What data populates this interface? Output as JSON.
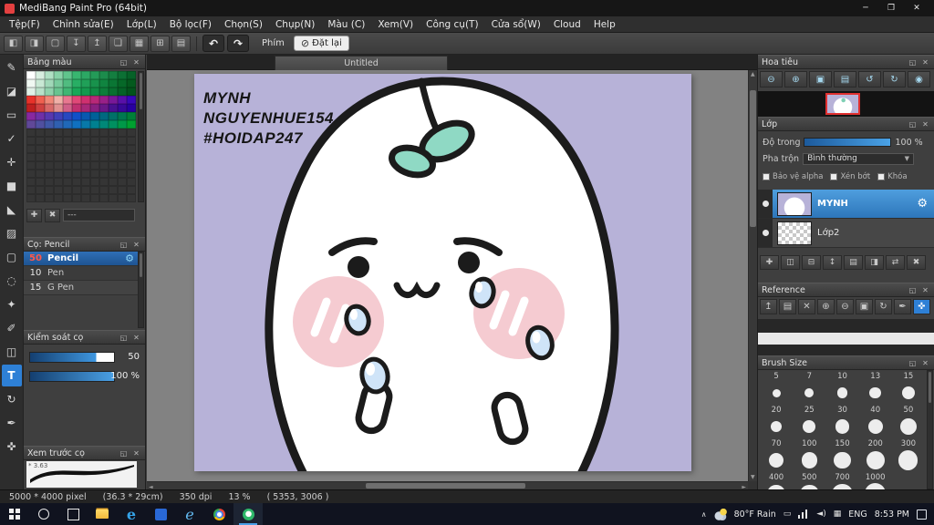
{
  "window": {
    "title": "MediBang Paint Pro (64bit)"
  },
  "menu_bar": {
    "items": [
      "Tệp(F)",
      "Chỉnh sửa(E)",
      "Lớp(L)",
      "Bộ lọc(F)",
      "Chọn(S)",
      "Chụp(N)",
      "Màu (C)",
      "Xem(V)",
      "Công cụ(T)",
      "Cửa sổ(W)",
      "Cloud",
      "Help"
    ]
  },
  "toolbar": {
    "icons": [
      "panels",
      "export",
      "new",
      "save",
      "upload",
      "comment",
      "palette",
      "grid",
      "material"
    ],
    "history": [
      "undo",
      "redo"
    ],
    "phim_label": "Phím",
    "reset_label": "Đặt lại"
  },
  "tools": {
    "items": [
      "brush",
      "eraser",
      "select-rect",
      "draw-check",
      "move",
      "fill",
      "bucket",
      "gradient",
      "select",
      "lasso",
      "magic-wand",
      "select-pen",
      "divide",
      "text",
      "frame",
      "eyedropper",
      "hand"
    ],
    "active": "text"
  },
  "canvas": {
    "tab_title": "Untitled",
    "background": "#b7b2d8",
    "watermark": [
      "MYNH",
      "NGUYENHUE154",
      "#HOIDAP247"
    ],
    "character_colors": {
      "outline": "#1b1b1b",
      "body": "#ffffff",
      "leaf": "#8fd9c4",
      "cheek": "#f5cbd1",
      "tear": "#cfe4f8"
    }
  },
  "panels": {
    "color_palette": {
      "title": "Bảng màu",
      "misc_label": "---",
      "rows": [
        [
          "#ffffff",
          "#d8eee0",
          "#b0e0c4",
          "#88d2a8",
          "#60c48c",
          "#38b670",
          "#2ca864",
          "#249a58",
          "#1c8c4c",
          "#147e40",
          "#0c7034",
          "#066228"
        ],
        [
          "#f0f8f2",
          "#c8e8d4",
          "#a0d8b8",
          "#78ca9c",
          "#50bc80",
          "#28ae64",
          "#20a058",
          "#18924c",
          "#108440",
          "#0a7634",
          "#066828",
          "#045a1e"
        ],
        [
          "#e0f0e6",
          "#b8e0c8",
          "#90d2ac",
          "#68c490",
          "#40b674",
          "#18a858",
          "#149a4e",
          "#108c44",
          "#0c7e3a",
          "#087030",
          "#046226",
          "#02541c"
        ],
        [
          "#e8322a",
          "#f06050",
          "#f08878",
          "#f0b0a8",
          "#e87890",
          "#e04878",
          "#d03070",
          "#b82878",
          "#982088",
          "#781898",
          "#5810a8",
          "#3808b8"
        ],
        [
          "#c02020",
          "#d04040",
          "#d86868",
          "#e09090",
          "#d06088",
          "#c03070",
          "#a82878",
          "#882080",
          "#681888",
          "#481090",
          "#380898",
          "#2800a0"
        ],
        [
          "#8828a0",
          "#7030a8",
          "#5838b0",
          "#4040b8",
          "#2848c0",
          "#1050c8",
          "#0858b0",
          "#006098",
          "#006880",
          "#007068",
          "#007850",
          "#008038"
        ],
        [
          "#604898",
          "#5050a0",
          "#4058a8",
          "#3060b0",
          "#2068b8",
          "#1070c0",
          "#0878a8",
          "#008090",
          "#008878",
          "#009060",
          "#009848",
          "#00a030"
        ]
      ],
      "empty_rows": 9
    },
    "brush": {
      "title": "Cọ: Pencil",
      "items": [
        {
          "size": "50",
          "name": "Pencil",
          "selected": true
        },
        {
          "size": "10",
          "name": "Pen",
          "selected": false
        },
        {
          "size": "15",
          "name": "G Pen",
          "selected": false
        }
      ]
    },
    "brush_control": {
      "title": "Kiểm soát cọ",
      "size_value": "50",
      "opacity_value": "100 %"
    },
    "brush_preview": {
      "title": "Xem trước cọ",
      "scale": "* 3.63"
    },
    "navigator": {
      "title": "Hoa tiêu",
      "icons": [
        "zoom-out",
        "zoom-in",
        "fit",
        "actual",
        "rotate-left",
        "rotate-right",
        "reset-view"
      ]
    },
    "layer": {
      "title": "Lớp",
      "opacity_label": "Độ trong",
      "opacity_value": "100 %",
      "blend_label": "Pha trộn",
      "blend_value": "Bình thường",
      "protect_alpha_label": "Bảo vệ alpha",
      "clip_label": "Xén bớt",
      "lock_label": "Khóa",
      "layers": [
        {
          "name": "MYNH",
          "selected": true
        },
        {
          "name": "Lớp2",
          "selected": false
        }
      ],
      "actions": [
        "layer-add",
        "layer-dup",
        "layer-merge",
        "layer-updown",
        "layer-folder",
        "layer-clip",
        "layer-transfer",
        "layer-delete"
      ]
    },
    "reference": {
      "title": "Reference",
      "icons": [
        "ref-up",
        "ref-folder",
        "ref-close",
        "ref-zoom-in",
        "ref-zoom-out",
        "ref-fit",
        "ref-rotate",
        "ref-eyedropper",
        "ref-hand"
      ],
      "active": "ref-hand"
    },
    "brush_size": {
      "title": "Brush Size",
      "rows": [
        [
          "5",
          "7",
          "10",
          "13",
          "15"
        ],
        [
          "20",
          "25",
          "30",
          "40",
          "50"
        ],
        [
          "70",
          "100",
          "150",
          "200",
          "300"
        ],
        [
          "400",
          "500",
          "700",
          "1000"
        ]
      ]
    }
  },
  "status_bar": {
    "dimensions": "5000 * 4000 pixel",
    "print_size": "(36.3 * 29cm)",
    "dpi": "350 dpi",
    "zoom": "13 %",
    "coords": "( 5353, 3006 )"
  },
  "taskbar": {
    "apps": [
      "start",
      "search",
      "task-view",
      "file-explorer",
      "edge",
      "app-blue",
      "ie",
      "chrome",
      "medibang"
    ],
    "active_app": "medibang",
    "tray": {
      "weather": "80°F Rain",
      "language": "ENG",
      "time": "8:53 PM"
    }
  }
}
